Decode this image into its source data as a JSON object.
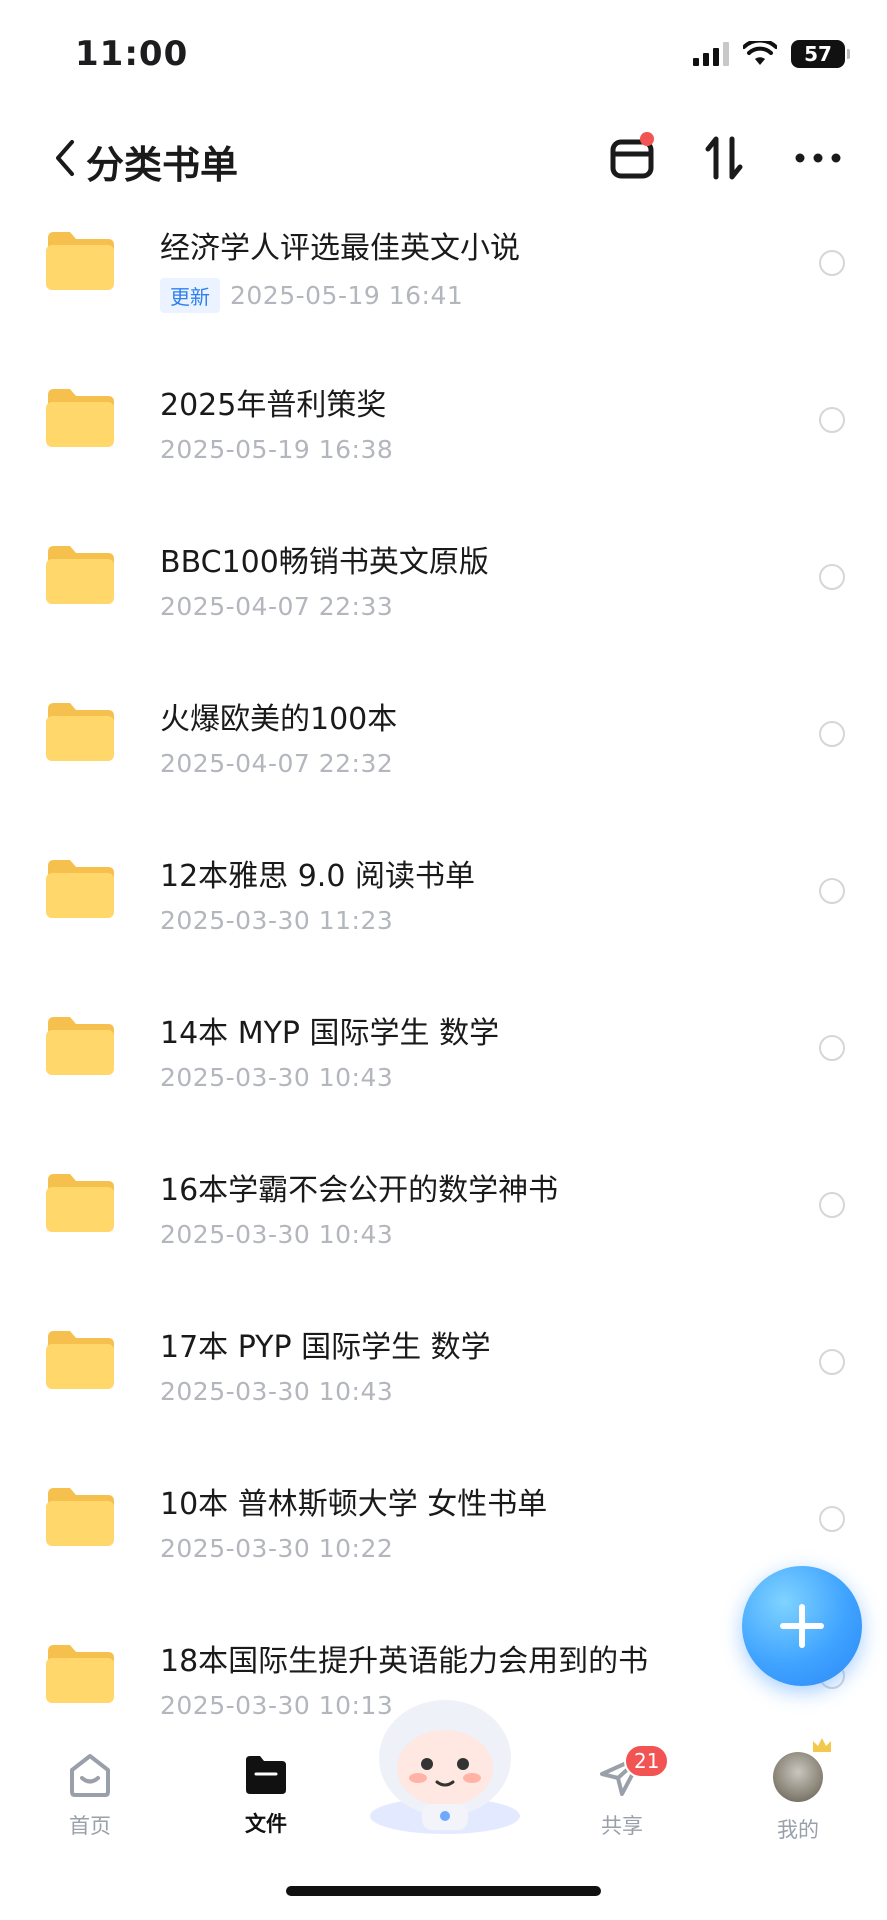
{
  "status_bar": {
    "time": "11:00",
    "battery": "57"
  },
  "header": {
    "title": "分类书单"
  },
  "files": [
    {
      "name": "经济学人评选最佳英文小说",
      "badge": "更新",
      "date": "2025-05-19 16:41"
    },
    {
      "name": "2025年普利策奖",
      "date": "2025-05-19 16:38"
    },
    {
      "name": "BBC100畅销书英文原版",
      "date": "2025-04-07 22:33"
    },
    {
      "name": "火爆欧美的100本",
      "date": "2025-04-07 22:32"
    },
    {
      "name": "12本雅思 9.0 阅读书单",
      "date": "2025-03-30 11:23"
    },
    {
      "name": "14本 MYP 国际学生 数学",
      "date": "2025-03-30 10:43"
    },
    {
      "name": "16本学霸不会公开的数学神书",
      "date": "2025-03-30 10:43"
    },
    {
      "name": "17本 PYP 国际学生 数学",
      "date": "2025-03-30 10:43"
    },
    {
      "name": "10本 普林斯顿大学 女性书单",
      "date": "2025-03-30 10:22"
    },
    {
      "name": "18本国际生提升英语能力会用到的书",
      "date": "2025-03-30 10:13"
    }
  ],
  "tabs": {
    "home": "首页",
    "files": "文件",
    "share": "共享",
    "share_badge": "21",
    "mine": "我的"
  },
  "colors": {
    "accent": "#2f80ed",
    "badge_red": "#f25353",
    "folder": "#ffd76a"
  }
}
